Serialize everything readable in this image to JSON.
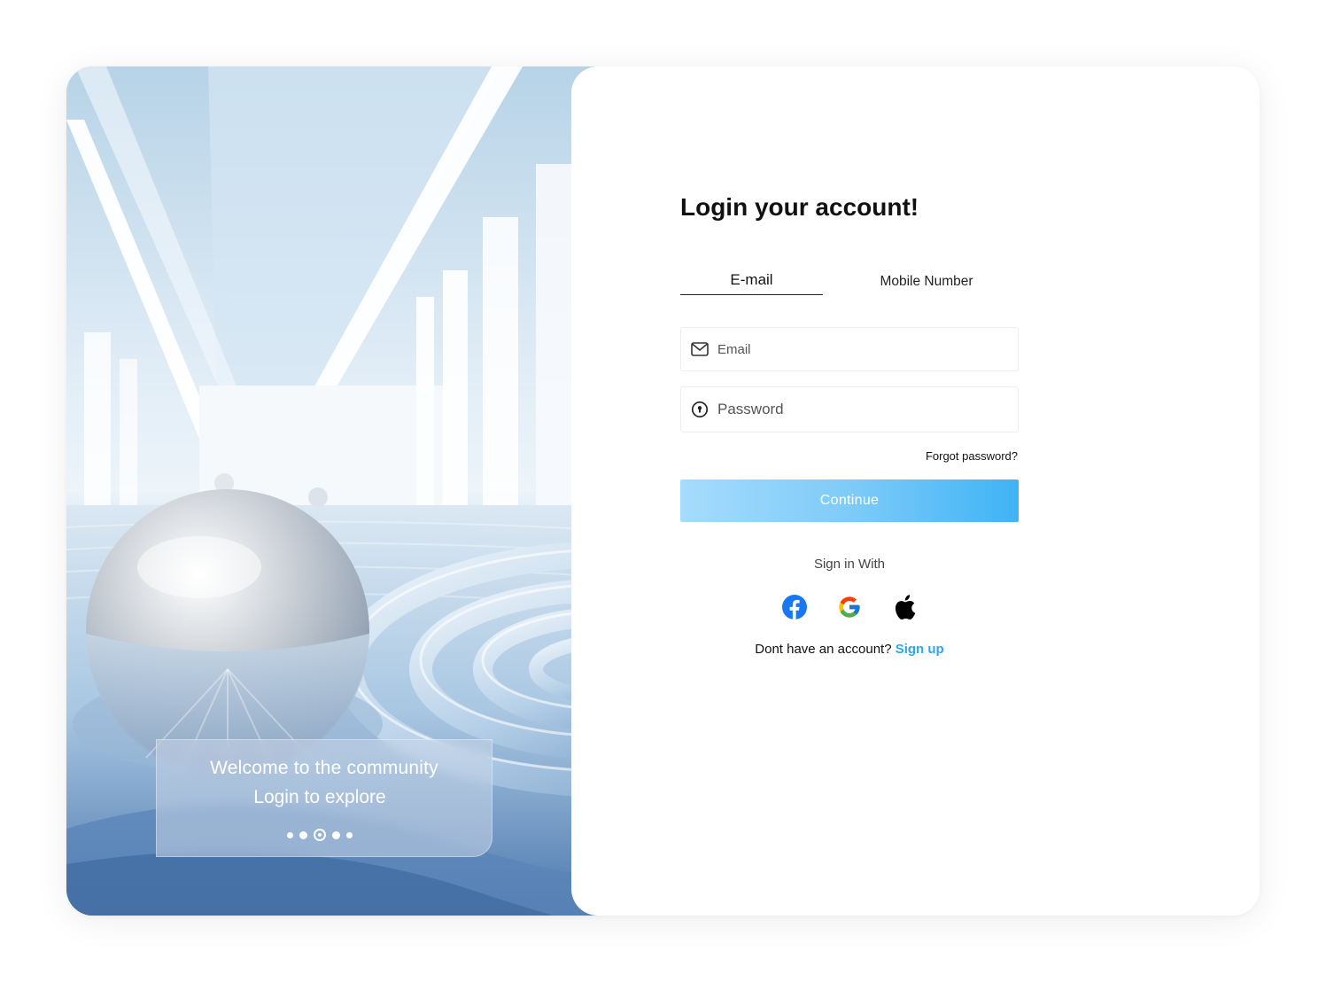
{
  "hero": {
    "welcome_line1": "Welcome to the community",
    "welcome_line2": "Login to explore",
    "carousel": {
      "total_slides": 5,
      "active_slide": 3
    }
  },
  "form": {
    "title": "Login your account!",
    "tabs": [
      {
        "label": "E-mail",
        "active": true
      },
      {
        "label": "Mobile Number",
        "active": false
      }
    ],
    "email": {
      "placeholder": "Email",
      "value": "",
      "icon": "mail-icon"
    },
    "password": {
      "placeholder": "Password",
      "value": "",
      "icon": "keyhole-icon"
    },
    "forgot_label": "Forgot password?",
    "continue_label": "Continue",
    "sign_in_with": "Sign in With",
    "social": [
      "facebook-icon",
      "google-icon",
      "apple-icon"
    ],
    "signup_prompt": "Dont have an account?",
    "signup_label": "Sign up"
  },
  "colors": {
    "accent": "#2aa7ee",
    "button_gradient_start": "#a6dcfd",
    "button_gradient_end": "#3fb3f6",
    "facebook": "#1877f2"
  }
}
